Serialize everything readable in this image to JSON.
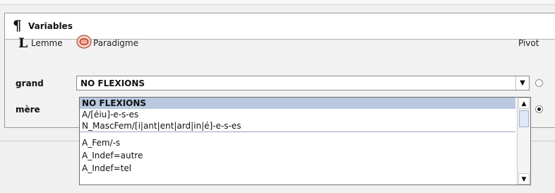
{
  "panel": {
    "title": "Variables",
    "para_icon": "¶",
    "lemme_icon_letter": "L",
    "lemme_label": "Lemme",
    "paradigme_label": "Paradigme",
    "pivot_label": "Pivot"
  },
  "rows": [
    {
      "label": "grand",
      "value": "NO FLEXIONS",
      "pivot": false
    },
    {
      "label": "mère",
      "value": "",
      "pivot": true
    }
  ],
  "dropdown": {
    "options": [
      "NO FLEXIONS",
      "A/[éiu]-e-s-es",
      "N_MascFem/[i|ant|ent|ard|in|é]-e-s-es",
      "A_Fem/-s",
      "A_Indef=autre",
      "A_Indef=tel"
    ],
    "selected_index": 0
  },
  "icons": {
    "dropdown_arrow": "▼",
    "scroll_up": "▲",
    "scroll_down": "▼"
  }
}
